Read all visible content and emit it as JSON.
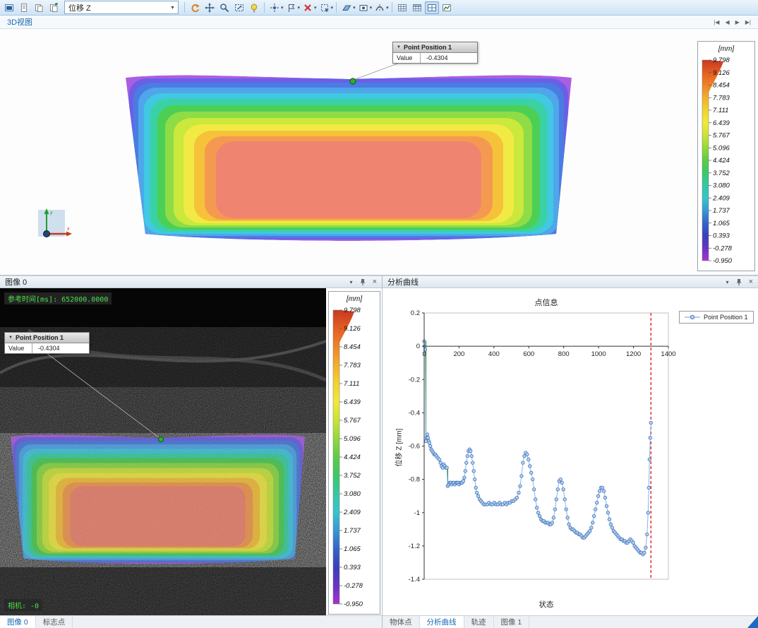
{
  "glyphs": {
    "caret": "▾",
    "close": "×",
    "tooltip_tri": "▼",
    "nav_first": "|◀",
    "nav_prev": "◀",
    "nav_next": "▶",
    "nav_last": "▶|"
  },
  "toolbar": {
    "display_mode_value": "位移 Z",
    "icons": [
      "app-window",
      "new-report",
      "copy",
      "duplicate",
      "reset-view",
      "pan-view",
      "zoom",
      "zoom-fit",
      "light",
      "create-point",
      "label-flag",
      "delete",
      "select-region",
      "surface-component",
      "camera-image",
      "section",
      "table-view",
      "table-view-2",
      "report-grid-active",
      "statistics"
    ]
  },
  "doc_tabs": {
    "view3d": "3D视图"
  },
  "view3d": {
    "tooltip": {
      "title": "Point Position 1",
      "key": "Value",
      "value": "-0.4304"
    }
  },
  "legend": {
    "unit": "[mm]",
    "values": [
      "9.798",
      "9.126",
      "8.454",
      "7.783",
      "7.111",
      "6.439",
      "5.767",
      "5.096",
      "4.424",
      "3.752",
      "3.080",
      "2.409",
      "1.737",
      "1.065",
      "0.393",
      "-0.278",
      "-0.950"
    ]
  },
  "colormap": {
    "scale": [
      "#c43a22",
      "#e85c20",
      "#f08428",
      "#f4ae2c",
      "#f4d22e",
      "#f0ea38",
      "#c8e436",
      "#94d83c",
      "#5ccc44",
      "#3cc868",
      "#34c8a4",
      "#38c4cc",
      "#3898d4",
      "#3464c8",
      "#3840bc",
      "#6834c4",
      "#a832d0"
    ],
    "contour_bands": [
      "#aa5ee4",
      "#6b5fe6",
      "#4a7ce2",
      "#4fa6ea",
      "#41c8e2",
      "#3ad2a4",
      "#4ccf55",
      "#8edc46",
      "#cbe83c",
      "#f2ea44",
      "#f6c23a",
      "#f49a50",
      "#ef8570"
    ]
  },
  "image_panel": {
    "title": "图像 0",
    "ref_time": "参考时间[ms]: 652000.0000",
    "camera_label": "相机: -0",
    "tooltip": {
      "title": "Point Position 1",
      "key": "Value",
      "value": "-0.4304"
    },
    "tabs": [
      {
        "label": "图像 0"
      },
      {
        "label": "标志点"
      }
    ]
  },
  "curve_panel": {
    "title": "分析曲线",
    "tabs": [
      {
        "label": "物体点"
      },
      {
        "label": "分析曲线"
      },
      {
        "label": "轨迹"
      },
      {
        "label": "图像 1"
      }
    ]
  },
  "chart_data": {
    "type": "scatter",
    "title": "点信息",
    "xlabel": "状态",
    "ylabel": "位移 Z [mm]",
    "xlim": [
      0,
      1400
    ],
    "ylim": [
      -1.4,
      0.2
    ],
    "xticks": [
      0,
      200,
      400,
      600,
      800,
      1000,
      1200,
      1400
    ],
    "ytick_labels": [
      "0.2",
      "0",
      "-0.2",
      "-0.4",
      "-0.6",
      "-0.8",
      "-1",
      "-1.2",
      "-1.4"
    ],
    "legend_entries": [
      "Point Position 1"
    ],
    "legend_position": "top-right",
    "grid": false,
    "marker_color": "#b8d4f0",
    "marker_edge": "#4878c0",
    "line_color": "#8ab4e8",
    "current_state_line": {
      "x": 1300,
      "color": "#e03030",
      "style": "dashed"
    },
    "green_segments": [
      {
        "x": 10,
        "y1": 0.03,
        "y2": -0.57
      },
      {
        "x": 135,
        "y1": -0.73,
        "y2": -0.84
      }
    ],
    "series": [
      {
        "name": "Point Position 1",
        "points": [
          [
            0,
            0.03
          ],
          [
            3,
            0.0
          ],
          [
            6,
            -0.02
          ],
          [
            10,
            -0.57
          ],
          [
            14,
            -0.55
          ],
          [
            18,
            -0.53
          ],
          [
            22,
            -0.55
          ],
          [
            26,
            -0.57
          ],
          [
            30,
            -0.58
          ],
          [
            35,
            -0.6
          ],
          [
            40,
            -0.62
          ],
          [
            46,
            -0.63
          ],
          [
            52,
            -0.64
          ],
          [
            58,
            -0.65
          ],
          [
            64,
            -0.65
          ],
          [
            70,
            -0.66
          ],
          [
            78,
            -0.67
          ],
          [
            86,
            -0.68
          ],
          [
            94,
            -0.7
          ],
          [
            100,
            -0.72
          ],
          [
            106,
            -0.73
          ],
          [
            112,
            -0.71
          ],
          [
            118,
            -0.72
          ],
          [
            124,
            -0.73
          ],
          [
            130,
            -0.73
          ],
          [
            135,
            -0.84
          ],
          [
            140,
            -0.83
          ],
          [
            146,
            -0.82
          ],
          [
            152,
            -0.82
          ],
          [
            158,
            -0.83
          ],
          [
            164,
            -0.82
          ],
          [
            170,
            -0.82
          ],
          [
            176,
            -0.83
          ],
          [
            182,
            -0.82
          ],
          [
            188,
            -0.82
          ],
          [
            194,
            -0.82
          ],
          [
            200,
            -0.83
          ],
          [
            206,
            -0.82
          ],
          [
            212,
            -0.82
          ],
          [
            218,
            -0.82
          ],
          [
            224,
            -0.81
          ],
          [
            230,
            -0.79
          ],
          [
            236,
            -0.75
          ],
          [
            242,
            -0.7
          ],
          [
            248,
            -0.66
          ],
          [
            254,
            -0.63
          ],
          [
            260,
            -0.62
          ],
          [
            266,
            -0.63
          ],
          [
            272,
            -0.66
          ],
          [
            278,
            -0.7
          ],
          [
            284,
            -0.75
          ],
          [
            290,
            -0.8
          ],
          [
            296,
            -0.85
          ],
          [
            302,
            -0.88
          ],
          [
            310,
            -0.9
          ],
          [
            318,
            -0.92
          ],
          [
            326,
            -0.93
          ],
          [
            334,
            -0.94
          ],
          [
            342,
            -0.95
          ],
          [
            352,
            -0.95
          ],
          [
            362,
            -0.95
          ],
          [
            372,
            -0.94
          ],
          [
            382,
            -0.95
          ],
          [
            392,
            -0.95
          ],
          [
            402,
            -0.94
          ],
          [
            412,
            -0.95
          ],
          [
            422,
            -0.95
          ],
          [
            432,
            -0.94
          ],
          [
            442,
            -0.95
          ],
          [
            452,
            -0.95
          ],
          [
            462,
            -0.94
          ],
          [
            472,
            -0.95
          ],
          [
            482,
            -0.94
          ],
          [
            492,
            -0.94
          ],
          [
            502,
            -0.93
          ],
          [
            512,
            -0.93
          ],
          [
            522,
            -0.92
          ],
          [
            532,
            -0.91
          ],
          [
            542,
            -0.88
          ],
          [
            550,
            -0.84
          ],
          [
            558,
            -0.78
          ],
          [
            566,
            -0.7
          ],
          [
            574,
            -0.66
          ],
          [
            582,
            -0.64
          ],
          [
            590,
            -0.65
          ],
          [
            598,
            -0.68
          ],
          [
            606,
            -0.72
          ],
          [
            614,
            -0.76
          ],
          [
            622,
            -0.8
          ],
          [
            630,
            -0.86
          ],
          [
            638,
            -0.92
          ],
          [
            646,
            -0.97
          ],
          [
            654,
            -1.0
          ],
          [
            662,
            -1.02
          ],
          [
            670,
            -1.04
          ],
          [
            678,
            -1.05
          ],
          [
            686,
            -1.05
          ],
          [
            694,
            -1.06
          ],
          [
            702,
            -1.06
          ],
          [
            710,
            -1.06
          ],
          [
            718,
            -1.07
          ],
          [
            726,
            -1.07
          ],
          [
            734,
            -1.06
          ],
          [
            742,
            -1.03
          ],
          [
            750,
            -0.98
          ],
          [
            758,
            -0.92
          ],
          [
            766,
            -0.86
          ],
          [
            774,
            -0.81
          ],
          [
            782,
            -0.8
          ],
          [
            790,
            -0.82
          ],
          [
            798,
            -0.86
          ],
          [
            806,
            -0.92
          ],
          [
            814,
            -0.98
          ],
          [
            822,
            -1.03
          ],
          [
            830,
            -1.07
          ],
          [
            838,
            -1.09
          ],
          [
            846,
            -1.1
          ],
          [
            854,
            -1.1
          ],
          [
            862,
            -1.11
          ],
          [
            870,
            -1.12
          ],
          [
            878,
            -1.12
          ],
          [
            886,
            -1.13
          ],
          [
            894,
            -1.13
          ],
          [
            902,
            -1.14
          ],
          [
            910,
            -1.15
          ],
          [
            918,
            -1.15
          ],
          [
            926,
            -1.14
          ],
          [
            934,
            -1.13
          ],
          [
            942,
            -1.12
          ],
          [
            950,
            -1.11
          ],
          [
            958,
            -1.09
          ],
          [
            966,
            -1.06
          ],
          [
            974,
            -1.02
          ],
          [
            982,
            -0.98
          ],
          [
            990,
            -0.94
          ],
          [
            998,
            -0.9
          ],
          [
            1006,
            -0.87
          ],
          [
            1014,
            -0.85
          ],
          [
            1022,
            -0.85
          ],
          [
            1030,
            -0.87
          ],
          [
            1038,
            -0.91
          ],
          [
            1046,
            -0.96
          ],
          [
            1054,
            -1.0
          ],
          [
            1062,
            -1.04
          ],
          [
            1070,
            -1.07
          ],
          [
            1078,
            -1.09
          ],
          [
            1086,
            -1.11
          ],
          [
            1094,
            -1.12
          ],
          [
            1102,
            -1.13
          ],
          [
            1110,
            -1.14
          ],
          [
            1118,
            -1.15
          ],
          [
            1126,
            -1.16
          ],
          [
            1134,
            -1.16
          ],
          [
            1142,
            -1.17
          ],
          [
            1150,
            -1.17
          ],
          [
            1158,
            -1.18
          ],
          [
            1166,
            -1.18
          ],
          [
            1174,
            -1.17
          ],
          [
            1182,
            -1.16
          ],
          [
            1190,
            -1.17
          ],
          [
            1198,
            -1.18
          ],
          [
            1206,
            -1.2
          ],
          [
            1214,
            -1.21
          ],
          [
            1222,
            -1.22
          ],
          [
            1230,
            -1.23
          ],
          [
            1238,
            -1.24
          ],
          [
            1246,
            -1.24
          ],
          [
            1254,
            -1.25
          ],
          [
            1262,
            -1.24
          ],
          [
            1270,
            -1.21
          ],
          [
            1278,
            -1.13
          ],
          [
            1284,
            -1.0
          ],
          [
            1288,
            -0.85
          ],
          [
            1292,
            -0.68
          ],
          [
            1296,
            -0.55
          ],
          [
            1300,
            -0.46
          ]
        ]
      }
    ]
  }
}
